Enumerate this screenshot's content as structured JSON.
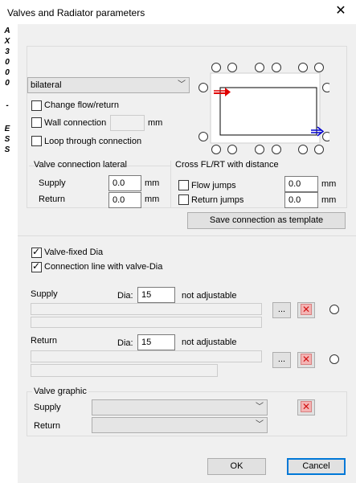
{
  "window": {
    "title": "Valves and Radiator parameters",
    "close_symbol": "✕"
  },
  "side_text": [
    "A",
    "X",
    "3",
    "0",
    "0",
    "0",
    "-",
    "E",
    "S",
    "S"
  ],
  "connection_type": {
    "selected": "bilateral"
  },
  "options": {
    "change_flow_return": "Change flow/return",
    "wall_connection": "Wall connection",
    "wall_connection_unit": "mm",
    "loop_through": "Loop through connection"
  },
  "lateral": {
    "title": "Valve connection lateral",
    "supply_label": "Supply",
    "supply_value": "0.0",
    "return_label": "Return",
    "return_value": "0.0",
    "unit": "mm"
  },
  "cross": {
    "title": "Cross FL/RT with distance",
    "flow_jumps_label": "Flow jumps",
    "flow_jumps_value": "0.0",
    "return_jumps_label": "Return jumps",
    "return_jumps_value": "0.0",
    "unit": "mm"
  },
  "save_template_label": "Save connection as template",
  "valve_fixed_dia": "Valve-fixed Dia",
  "connection_line_dia": "Connection line with valve-Dia",
  "supply": {
    "label": "Supply",
    "dia_label": "Dia:",
    "dia_value": "15",
    "adjust_text": "not adjustable",
    "browse_label": "..."
  },
  "return": {
    "label": "Return",
    "dia_label": "Dia:",
    "dia_value": "15",
    "adjust_text": "not adjustable",
    "browse_label": "..."
  },
  "valve_graphic": {
    "title": "Valve graphic",
    "supply_label": "Supply",
    "return_label": "Return"
  },
  "ok_label": "OK",
  "cancel_label": "Cancel",
  "colors": {
    "flow_arrow": "#e00000",
    "return_arrow": "#0000d0",
    "accent": "#0078d7"
  }
}
